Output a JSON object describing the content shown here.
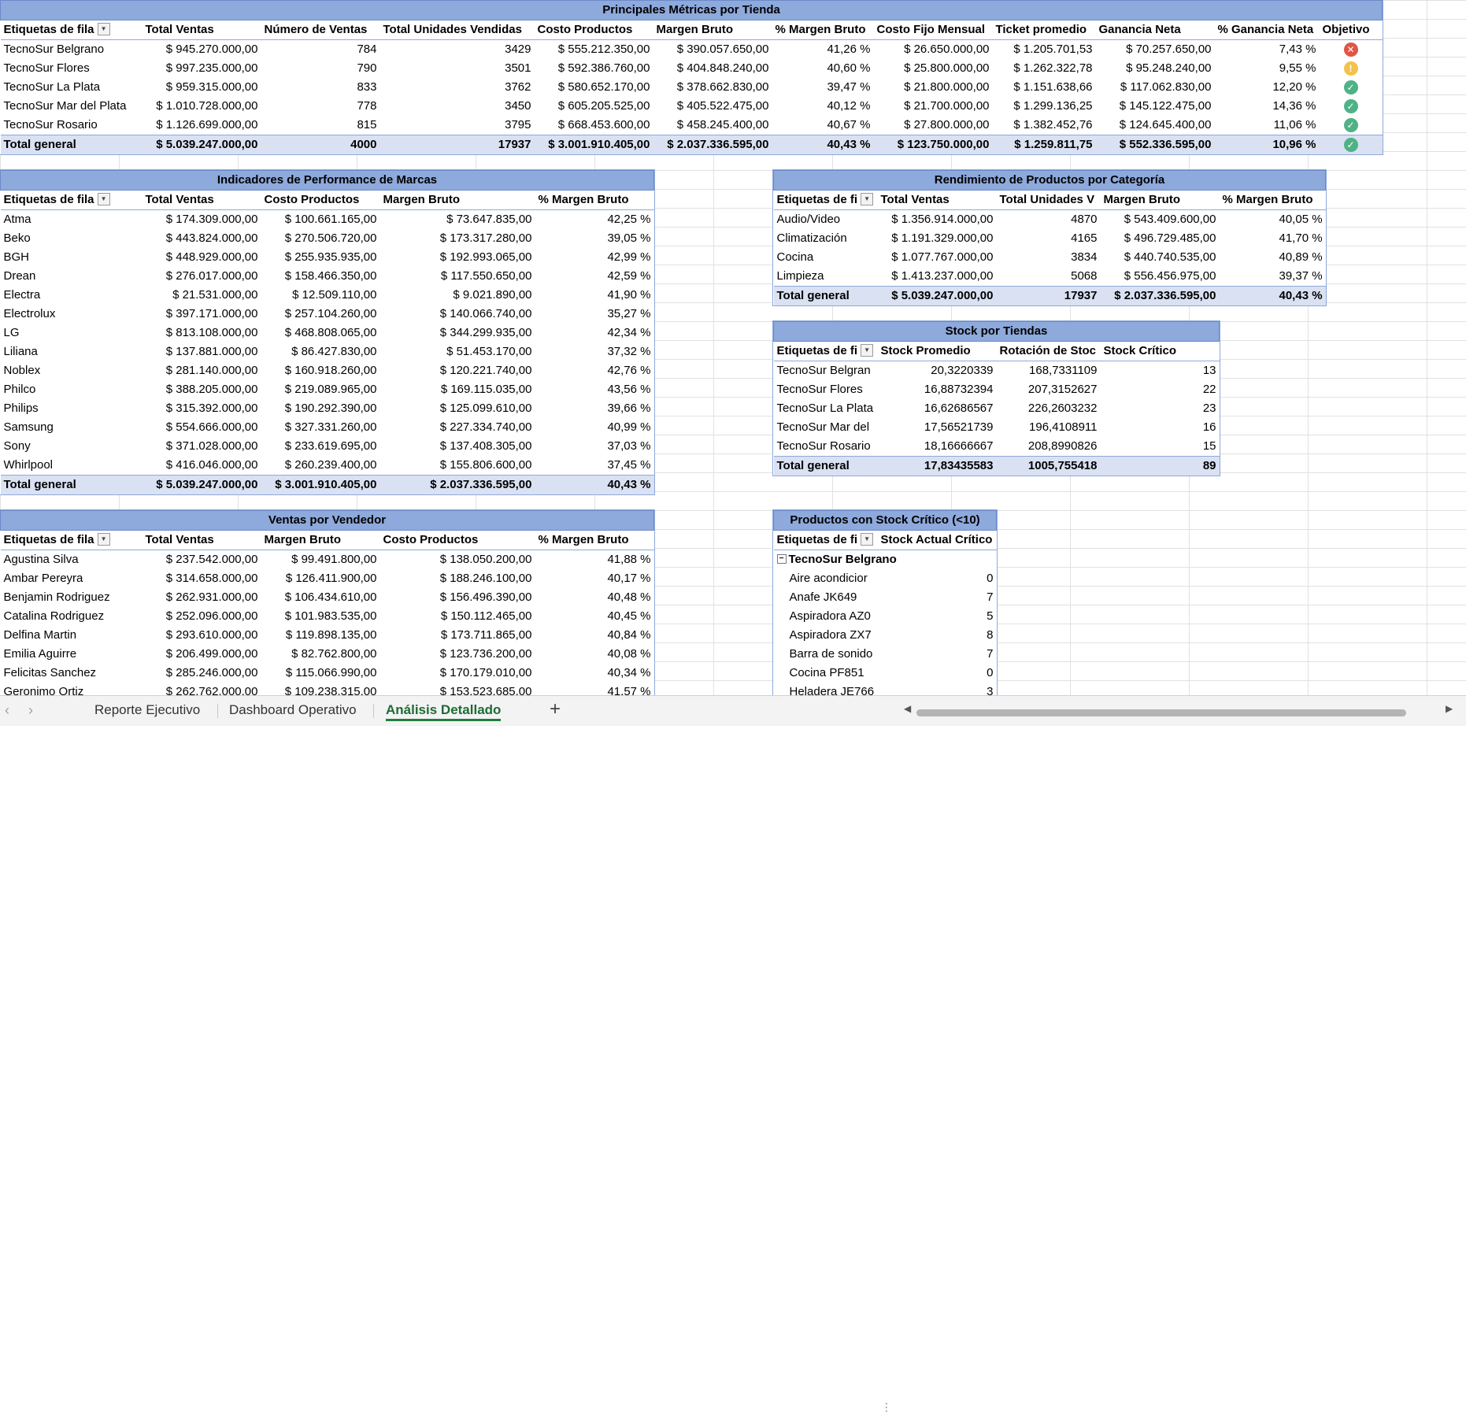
{
  "store_metrics": {
    "title": "Principales Métricas por Tienda",
    "headers": [
      "Etiquetas de fila",
      "Total Ventas",
      "Número de Ventas",
      "Total Unidades Vendidas",
      "Costo Productos",
      "Margen Bruto",
      "% Margen Bruto",
      "Costo Fijo Mensual",
      "Ticket promedio",
      "Ganancia Neta",
      "% Ganancia Neta",
      "Objetivo"
    ],
    "rows": [
      [
        "TecnoSur Belgrano",
        "$ 945.270.000,00",
        "784",
        "3429",
        "$ 555.212.350,00",
        "$ 390.057.650,00",
        "41,26 %",
        "$ 26.650.000,00",
        "$ 1.205.701,53",
        "$ 70.257.650,00",
        "7,43 %",
        "bad"
      ],
      [
        "TecnoSur Flores",
        "$ 997.235.000,00",
        "790",
        "3501",
        "$ 592.386.760,00",
        "$ 404.848.240,00",
        "40,60 %",
        "$ 25.800.000,00",
        "$ 1.262.322,78",
        "$ 95.248.240,00",
        "9,55 %",
        "warn"
      ],
      [
        "TecnoSur La Plata",
        "$ 959.315.000,00",
        "833",
        "3762",
        "$ 580.652.170,00",
        "$ 378.662.830,00",
        "39,47 %",
        "$ 21.800.000,00",
        "$ 1.151.638,66",
        "$ 117.062.830,00",
        "12,20 %",
        "ok"
      ],
      [
        "TecnoSur Mar del Plata",
        "$ 1.010.728.000,00",
        "778",
        "3450",
        "$ 605.205.525,00",
        "$ 405.522.475,00",
        "40,12 %",
        "$ 21.700.000,00",
        "$ 1.299.136,25",
        "$ 145.122.475,00",
        "14,36 %",
        "ok"
      ],
      [
        "TecnoSur Rosario",
        "$ 1.126.699.000,00",
        "815",
        "3795",
        "$ 668.453.600,00",
        "$ 458.245.400,00",
        "40,67 %",
        "$ 27.800.000,00",
        "$ 1.382.452,76",
        "$ 124.645.400,00",
        "11,06 %",
        "ok"
      ]
    ],
    "total": [
      "Total general",
      "$ 5.039.247.000,00",
      "4000",
      "17937",
      "$ 3.001.910.405,00",
      "$ 2.037.336.595,00",
      "40,43 %",
      "$ 123.750.000,00",
      "$ 1.259.811,75",
      "$ 552.336.595,00",
      "10,96 %",
      "ok"
    ]
  },
  "brands": {
    "title": "Indicadores de Performance de Marcas",
    "headers": [
      "Etiquetas de fila",
      "Total Ventas",
      "Costo Productos",
      "Margen Bruto",
      "% Margen Bruto"
    ],
    "rows": [
      [
        "Atma",
        "$ 174.309.000,00",
        "$ 100.661.165,00",
        "$ 73.647.835,00",
        "42,25 %"
      ],
      [
        "Beko",
        "$ 443.824.000,00",
        "$ 270.506.720,00",
        "$ 173.317.280,00",
        "39,05 %"
      ],
      [
        "BGH",
        "$ 448.929.000,00",
        "$ 255.935.935,00",
        "$ 192.993.065,00",
        "42,99 %"
      ],
      [
        "Drean",
        "$ 276.017.000,00",
        "$ 158.466.350,00",
        "$ 117.550.650,00",
        "42,59 %"
      ],
      [
        "Electra",
        "$ 21.531.000,00",
        "$ 12.509.110,00",
        "$ 9.021.890,00",
        "41,90 %"
      ],
      [
        "Electrolux",
        "$ 397.171.000,00",
        "$ 257.104.260,00",
        "$ 140.066.740,00",
        "35,27 %"
      ],
      [
        "LG",
        "$ 813.108.000,00",
        "$ 468.808.065,00",
        "$ 344.299.935,00",
        "42,34 %"
      ],
      [
        "Liliana",
        "$ 137.881.000,00",
        "$ 86.427.830,00",
        "$ 51.453.170,00",
        "37,32 %"
      ],
      [
        "Noblex",
        "$ 281.140.000,00",
        "$ 160.918.260,00",
        "$ 120.221.740,00",
        "42,76 %"
      ],
      [
        "Philco",
        "$ 388.205.000,00",
        "$ 219.089.965,00",
        "$ 169.115.035,00",
        "43,56 %"
      ],
      [
        "Philips",
        "$ 315.392.000,00",
        "$ 190.292.390,00",
        "$ 125.099.610,00",
        "39,66 %"
      ],
      [
        "Samsung",
        "$ 554.666.000,00",
        "$ 327.331.260,00",
        "$ 227.334.740,00",
        "40,99 %"
      ],
      [
        "Sony",
        "$ 371.028.000,00",
        "$ 233.619.695,00",
        "$ 137.408.305,00",
        "37,03 %"
      ],
      [
        "Whirlpool",
        "$ 416.046.000,00",
        "$ 260.239.400,00",
        "$ 155.806.600,00",
        "37,45 %"
      ]
    ],
    "total": [
      "Total general",
      "$ 5.039.247.000,00",
      "$ 3.001.910.405,00",
      "$ 2.037.336.595,00",
      "40,43 %"
    ]
  },
  "categories": {
    "title": "Rendimiento de Productos por Categoría",
    "headers": [
      "Etiquetas de fi",
      "Total Ventas",
      "Total Unidades V",
      "Margen Bruto",
      "% Margen Bruto"
    ],
    "rows": [
      [
        "Audio/Video",
        "$ 1.356.914.000,00",
        "4870",
        "$ 543.409.600,00",
        "40,05 %"
      ],
      [
        "Climatización",
        "$ 1.191.329.000,00",
        "4165",
        "$ 496.729.485,00",
        "41,70 %"
      ],
      [
        "Cocina",
        "$ 1.077.767.000,00",
        "3834",
        "$ 440.740.535,00",
        "40,89 %"
      ],
      [
        "Limpieza",
        "$ 1.413.237.000,00",
        "5068",
        "$ 556.456.975,00",
        "39,37 %"
      ]
    ],
    "total": [
      "Total general",
      "$ 5.039.247.000,00",
      "17937",
      "$ 2.037.336.595,00",
      "40,43 %"
    ]
  },
  "stock": {
    "title": "Stock por Tiendas",
    "headers": [
      "Etiquetas de fi",
      "Stock Promedio",
      "Rotación de Stoc",
      "Stock Crítico"
    ],
    "rows": [
      [
        "TecnoSur Belgran",
        "20,3220339",
        "168,7331109",
        "13"
      ],
      [
        "TecnoSur Flores",
        "16,88732394",
        "207,3152627",
        "22"
      ],
      [
        "TecnoSur La Plata",
        "16,62686567",
        "226,2603232",
        "23"
      ],
      [
        "TecnoSur Mar del",
        "17,56521739",
        "196,4108911",
        "16"
      ],
      [
        "TecnoSur Rosario",
        "18,16666667",
        "208,8990826",
        "15"
      ]
    ],
    "total": [
      "Total general",
      "17,83435583",
      "1005,755418",
      "89"
    ]
  },
  "critical": {
    "title": "Productos con Stock Crítico (<10)",
    "headers": [
      "Etiquetas de fi",
      "Stock Actual Crítico"
    ],
    "group": "TecnoSur Belgrano",
    "rows": [
      [
        "Aire acondicior",
        "0"
      ],
      [
        "Anafe JK649",
        "7"
      ],
      [
        "Aspiradora AZ0",
        "5"
      ],
      [
        "Aspiradora ZX7",
        "8"
      ],
      [
        "Barra de sonido",
        "7"
      ],
      [
        "Cocina PF851",
        "0"
      ],
      [
        "Heladera JE766",
        "3"
      ]
    ]
  },
  "sellers": {
    "title": "Ventas por Vendedor",
    "headers": [
      "Etiquetas de fila",
      "Total Ventas",
      "Margen Bruto",
      "Costo Productos",
      "% Margen Bruto"
    ],
    "rows": [
      [
        "Agustina Silva",
        "$ 237.542.000,00",
        "$ 99.491.800,00",
        "$ 138.050.200,00",
        "41,88 %"
      ],
      [
        "Ambar Pereyra",
        "$ 314.658.000,00",
        "$ 126.411.900,00",
        "$ 188.246.100,00",
        "40,17 %"
      ],
      [
        "Benjamin Rodriguez",
        "$ 262.931.000,00",
        "$ 106.434.610,00",
        "$ 156.496.390,00",
        "40,48 %"
      ],
      [
        "Catalina Rodriguez",
        "$ 252.096.000,00",
        "$ 101.983.535,00",
        "$ 150.112.465,00",
        "40,45 %"
      ],
      [
        "Delfina Martin",
        "$ 293.610.000,00",
        "$ 119.898.135,00",
        "$ 173.711.865,00",
        "40,84 %"
      ],
      [
        "Emilia Aguirre",
        "$ 206.499.000,00",
        "$ 82.762.800,00",
        "$ 123.736.200,00",
        "40,08 %"
      ],
      [
        "Felicitas Sanchez",
        "$ 285.246.000,00",
        "$ 115.066.990,00",
        "$ 170.179.010,00",
        "40,34 %"
      ],
      [
        "Geronimo Ortiz",
        "$ 262.762.000,00",
        "$ 109.238.315,00",
        "$ 153.523.685,00",
        "41,57 %"
      ]
    ]
  },
  "sheet_tabs": [
    "Reporte Ejecutivo",
    "Dashboard Operativo",
    "Análisis Detallado"
  ],
  "active_tab": "Análisis Detallado",
  "icons": {
    "prev": "chevron-left-icon",
    "next": "chevron-right-icon",
    "add": "plus-icon",
    "bad": "x-circle-icon",
    "warn": "exclamation-circle-icon",
    "ok": "check-circle-icon"
  },
  "colors": {
    "header": "#8ea9db",
    "total": "#d9e1f2",
    "bad": "#e05545",
    "warn": "#f2c24c",
    "ok": "#4fb287",
    "active_tab": "#1e7e3f"
  }
}
